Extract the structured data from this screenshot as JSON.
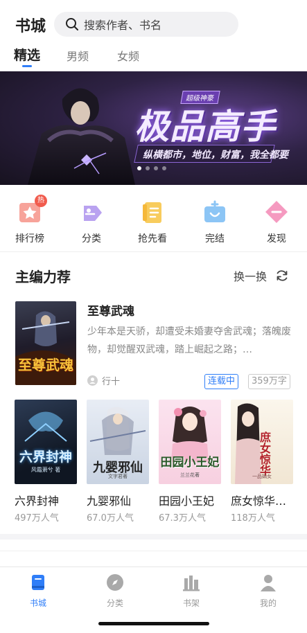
{
  "header": {
    "title": "书城",
    "search_placeholder": "搜索作者、书名"
  },
  "tabs": [
    {
      "label": "精选",
      "active": true
    },
    {
      "label": "男频",
      "active": false
    },
    {
      "label": "女频",
      "active": false
    }
  ],
  "banner": {
    "tag": "超级神豪",
    "title": "极品高手",
    "slogan": "纵横都市，地位，财富，我全都要",
    "dots_count": 4,
    "active_dot": 1
  },
  "quick_nav": [
    {
      "label": "排行榜",
      "icon": "ranking-icon",
      "badge": "热"
    },
    {
      "label": "分类",
      "icon": "category-icon"
    },
    {
      "label": "抢先看",
      "icon": "preview-icon"
    },
    {
      "label": "完结",
      "icon": "completed-icon"
    },
    {
      "label": "发现",
      "icon": "discover-icon"
    }
  ],
  "editor_picks": {
    "title": "主编力荐",
    "refresh_label": "换一换",
    "featured": {
      "cover_title": "至尊武魂",
      "name": "至尊武魂",
      "description": "少年本是天骄，却遭受未婚妻夺舍武魂；落魄废物，却觉醒双武魂，踏上崛起之路；…",
      "author": "行十",
      "status": "连载中",
      "words": "359万字"
    },
    "books": [
      {
        "name": "六界封神",
        "popularity": "497万人气",
        "cover_title": "六界封神",
        "cover_author": "风霜萧兮 著"
      },
      {
        "name": "九婴邪仙",
        "popularity": "67.0万人气",
        "cover_title": "九婴邪仙",
        "cover_author": "文字君著"
      },
      {
        "name": "田园小王妃",
        "popularity": "67.3万人气",
        "cover_title": "田园小王妃",
        "cover_author": "兰兰花著"
      },
      {
        "name": "庶女惊华…",
        "popularity": "118万人气",
        "cover_title": "庶女惊华",
        "cover_author": "一品嫡女"
      }
    ]
  },
  "tabbar": [
    {
      "label": "书城",
      "icon": "bookstore-icon",
      "active": true
    },
    {
      "label": "分类",
      "icon": "compass-icon",
      "active": false
    },
    {
      "label": "书架",
      "icon": "bookshelf-icon",
      "active": false
    },
    {
      "label": "我的",
      "icon": "profile-icon",
      "active": false
    }
  ],
  "colors": {
    "accent": "#2f7ef8",
    "hot_badge": "#f15b4d"
  }
}
